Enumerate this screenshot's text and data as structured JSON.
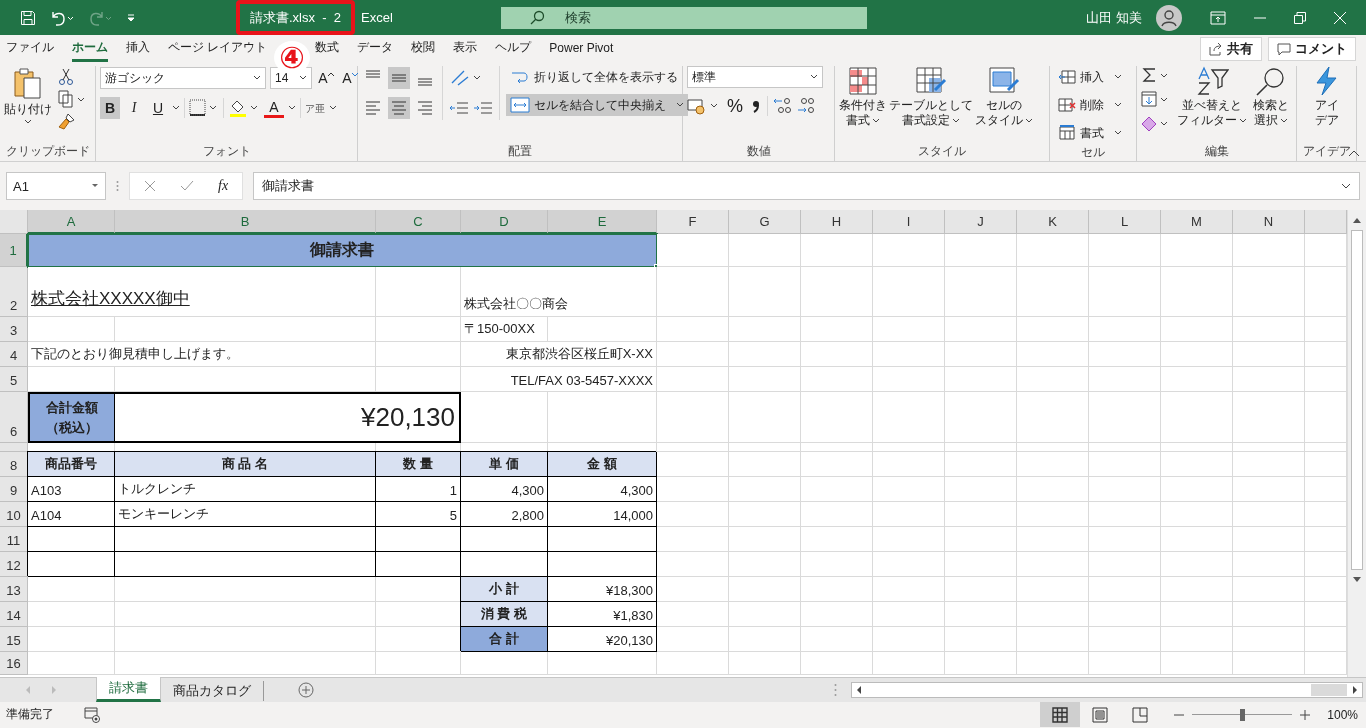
{
  "title_bar": {
    "redo": {
      "disabled": true
    },
    "file_title": "請求書.xlsx  -  2",
    "app": "Excel",
    "search": {
      "placeholder": "検索"
    },
    "user": "山田 知美"
  },
  "annotation": {
    "label": "④"
  },
  "ribbon_tabs": [
    {
      "label": "ファイル",
      "selected": false
    },
    {
      "label": "ホーム",
      "selected": true
    },
    {
      "label": "挿入",
      "selected": false
    },
    {
      "label": "ページ レイアウト",
      "selected": false
    },
    {
      "label": "数式",
      "selected": false
    },
    {
      "label": "データ",
      "selected": false
    },
    {
      "label": "校閲",
      "selected": false
    },
    {
      "label": "表示",
      "selected": false
    },
    {
      "label": "ヘルプ",
      "selected": false
    },
    {
      "label": "Power Pivot",
      "selected": false
    }
  ],
  "share_button": "共有",
  "comment_button": "コメント",
  "ribbon": {
    "clipboard": {
      "paste": "貼り付け",
      "label": "クリップボード"
    },
    "font": {
      "font_name": "游ゴシック",
      "font_size": "14",
      "grow": "A",
      "shrink": "A",
      "bold": {
        "label": "B",
        "on": true
      },
      "italic": "I",
      "underline": "U",
      "font_color": "A",
      "phonetic": "ア亜",
      "label": "フォント"
    },
    "alignment": {
      "vertical": [
        {
          "selected": false
        },
        {
          "selected": true
        },
        {
          "selected": false
        }
      ],
      "horizontal": [
        {
          "selected": false
        },
        {
          "selected": true
        },
        {
          "selected": false
        }
      ],
      "wrap_text": "折り返して全体を表示する",
      "merge_center": {
        "label": "セルを結合して中央揃え",
        "on": true
      },
      "label": "配置"
    },
    "number": {
      "format": "標準",
      "percent": "%",
      "label": "数値"
    },
    "styles": {
      "conditional": [
        "条件付き",
        "書式"
      ],
      "as_table": [
        "テーブルとして",
        "書式設定"
      ],
      "cell_styles": [
        "セルの",
        "スタイル"
      ],
      "label": "スタイル"
    },
    "cells": {
      "insert": "挿入",
      "delete": "削除",
      "format": "書式",
      "label": "セル"
    },
    "editing": {
      "sort_filter": [
        "並べ替えと",
        "フィルター"
      ],
      "find_select": [
        "検索と",
        "選択"
      ],
      "label": "編集"
    },
    "ideas": {
      "ideas": [
        "アイ",
        "デア"
      ],
      "label": "アイデア"
    }
  },
  "formula_bar": {
    "name_box": "A1",
    "function_button": "fx",
    "formula": "御請求書"
  },
  "columns": [
    {
      "label": "A",
      "selected": true
    },
    {
      "label": "B",
      "selected": true
    },
    {
      "label": "C",
      "selected": true
    },
    {
      "label": "D",
      "selected": true
    },
    {
      "label": "E",
      "selected": true
    },
    {
      "label": "F",
      "selected": false
    },
    {
      "label": "G",
      "selected": false
    },
    {
      "label": "H",
      "selected": false
    },
    {
      "label": "I",
      "selected": false
    },
    {
      "label": "J",
      "selected": false
    },
    {
      "label": "K",
      "selected": false
    },
    {
      "label": "L",
      "selected": false
    },
    {
      "label": "M",
      "selected": false
    },
    {
      "label": "N",
      "selected": false
    },
    {
      "selected": false
    }
  ],
  "rows": [
    {
      "label": "1",
      "selected": true,
      "kind": "title",
      "cells": [
        {
          "text": "御請求書",
          "kind": "title",
          "selected": true
        }
      ]
    },
    {
      "label": "2",
      "selected": false,
      "kind": "tall",
      "cells": [
        {
          "text": "株式会社XXXXX御中",
          "kind": "addressee",
          "selected": false
        },
        {
          "selected": false
        },
        {
          "text": "株式会社〇〇商会",
          "kind": "address",
          "selected": false
        }
      ]
    },
    {
      "label": "3",
      "selected": false,
      "kind": "normal",
      "cells": [
        {
          "selected": false
        },
        {
          "selected": false
        },
        {
          "selected": false
        },
        {
          "text": "〒150-00XX",
          "kind": "text",
          "selected": false
        },
        {
          "selected": false
        }
      ]
    },
    {
      "label": "4",
      "selected": false,
      "kind": "normal",
      "cells": [
        {
          "text": "下記のとおり御見積申し上げます。",
          "kind": "note",
          "selected": false
        },
        {
          "selected": false
        },
        {
          "text": "東京都渋谷区桜丘町X-XX",
          "kind": "right",
          "selected": false
        }
      ]
    },
    {
      "label": "5",
      "selected": false,
      "kind": "normal",
      "cells": [
        {
          "selected": false
        },
        {
          "selected": false
        },
        {
          "selected": false
        },
        {
          "text": "TEL/FAX 03-5457-XXXX",
          "kind": "right",
          "selected": false
        }
      ]
    },
    {
      "label": "6",
      "selected": false,
      "kind": "total",
      "cells": [
        {
          "text": [
            "合計金額",
            "（税込）"
          ],
          "kind": "total-label",
          "selected": false
        },
        {
          "text": "¥20,130",
          "kind": "total-value",
          "selected": false
        },
        {
          "selected": false
        },
        {
          "selected": false
        }
      ]
    },
    {
      "selected": false,
      "kind": "thin",
      "cells": [
        {
          "selected": false
        },
        {
          "selected": false
        },
        {
          "selected": false
        },
        {
          "selected": false
        },
        {
          "selected": false
        }
      ]
    },
    {
      "label": "8",
      "selected": false,
      "kind": "normal",
      "cells": [
        {
          "text": "商品番号",
          "kind": "th",
          "selected": false
        },
        {
          "text": "商 品 名",
          "kind": "th",
          "selected": false
        },
        {
          "text": "数 量",
          "kind": "th",
          "selected": false
        },
        {
          "text": "単 価",
          "kind": "th",
          "selected": false
        },
        {
          "text": "金 額",
          "kind": "th",
          "selected": false
        }
      ]
    },
    {
      "label": "9",
      "selected": false,
      "kind": "normal",
      "cells": [
        {
          "text": "A103",
          "kind": "td",
          "selected": false
        },
        {
          "text": "トルクレンチ",
          "kind": "td",
          "selected": false
        },
        {
          "text": "1",
          "kind": "num",
          "selected": false
        },
        {
          "text": "4,300",
          "kind": "num",
          "selected": false
        },
        {
          "text": "4,300",
          "kind": "num",
          "selected": false
        }
      ]
    },
    {
      "label": "10",
      "selected": false,
      "kind": "normal",
      "cells": [
        {
          "text": "A104",
          "kind": "td",
          "selected": false
        },
        {
          "text": "モンキーレンチ",
          "kind": "td",
          "selected": false
        },
        {
          "text": "5",
          "kind": "num",
          "selected": false
        },
        {
          "text": "2,800",
          "kind": "num",
          "selected": false
        },
        {
          "text": "14,000",
          "kind": "num",
          "selected": false
        }
      ]
    },
    {
      "label": "11",
      "selected": false,
      "kind": "normal",
      "cells": [
        {
          "kind": "td",
          "selected": false
        },
        {
          "kind": "td",
          "selected": false
        },
        {
          "kind": "td",
          "selected": false
        },
        {
          "kind": "td",
          "selected": false
        },
        {
          "kind": "td",
          "selected": false
        }
      ]
    },
    {
      "label": "12",
      "selected": false,
      "kind": "normal",
      "cells": [
        {
          "kind": "td",
          "selected": false
        },
        {
          "kind": "td",
          "selected": false
        },
        {
          "kind": "td",
          "selected": false
        },
        {
          "kind": "td",
          "selected": false
        },
        {
          "kind": "td",
          "selected": false
        }
      ]
    },
    {
      "label": "13",
      "selected": false,
      "kind": "normal",
      "cells": [
        {
          "selected": false
        },
        {
          "selected": false
        },
        {
          "selected": false
        },
        {
          "text": "小 計",
          "kind": "th",
          "selected": false
        },
        {
          "text": "¥18,300",
          "kind": "num",
          "selected": false
        }
      ]
    },
    {
      "label": "14",
      "selected": false,
      "kind": "normal",
      "cells": [
        {
          "selected": false
        },
        {
          "selected": false
        },
        {
          "selected": false
        },
        {
          "text": "消 費 税",
          "kind": "th",
          "selected": false
        },
        {
          "text": "¥1,830",
          "kind": "num",
          "selected": false
        }
      ]
    },
    {
      "label": "15",
      "selected": false,
      "kind": "normal",
      "cells": [
        {
          "selected": false
        },
        {
          "selected": false
        },
        {
          "selected": false
        },
        {
          "text": "合 計",
          "kind": "grand",
          "selected": false
        },
        {
          "text": "¥20,130",
          "kind": "num",
          "selected": false
        }
      ]
    },
    {
      "label": "16",
      "selected": false,
      "kind": "partial",
      "cells": [
        {
          "selected": false
        },
        {
          "selected": false
        },
        {
          "selected": false
        },
        {
          "selected": false
        },
        {
          "selected": false
        }
      ]
    }
  ],
  "sheet_tabs": [
    {
      "label": "請求書",
      "selected": true
    },
    {
      "label": "商品カタログ",
      "selected": false
    }
  ],
  "status_bar": {
    "status": "準備完了",
    "view_modes": [
      {
        "selected": true
      },
      {
        "selected": false
      },
      {
        "selected": false
      }
    ],
    "zoom": {
      "level": 0.5,
      "reading": "100%"
    }
  }
}
